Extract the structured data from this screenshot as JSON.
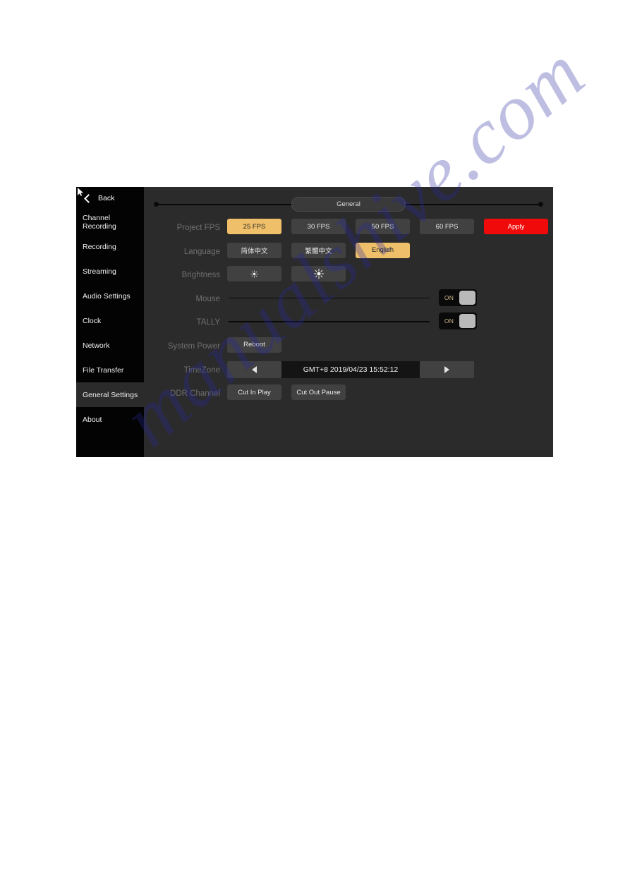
{
  "watermark": {
    "text": "manualshive.com"
  },
  "panel": {
    "topbar": {
      "section_label": "General"
    },
    "sidebar": {
      "back_label": "Back",
      "items": [
        {
          "label": "Channel Recording",
          "selected": false
        },
        {
          "label": "Recording",
          "selected": false
        },
        {
          "label": "Streaming",
          "selected": false
        },
        {
          "label": "Audio Settings",
          "selected": false
        },
        {
          "label": "Clock",
          "selected": false
        },
        {
          "label": "Network",
          "selected": false
        },
        {
          "label": "File Transfer",
          "selected": false
        },
        {
          "label": "General Settings",
          "selected": true
        },
        {
          "label": "About",
          "selected": false
        }
      ]
    },
    "rows": {
      "project_fps": {
        "label": "Project FPS",
        "options": [
          "25 FPS",
          "30 FPS",
          "50 FPS",
          "60 FPS"
        ],
        "selected": "25 FPS",
        "apply_label": "Apply"
      },
      "language": {
        "label": "Language",
        "options": [
          "简体中文",
          "繁體中文",
          "English"
        ],
        "selected": "English"
      },
      "brightness": {
        "label": "Brightness",
        "decrease_icon": "sun-small-icon",
        "increase_icon": "sun-large-icon"
      },
      "mouse": {
        "label": "Mouse",
        "toggle_state": "ON"
      },
      "tally": {
        "label": "TALLY",
        "toggle_state": "ON"
      },
      "system_power": {
        "label": "System Power",
        "reboot_label": "Reboot"
      },
      "timezone": {
        "label": "TimeZone",
        "prev_icon": "triangle-left-icon",
        "next_icon": "triangle-right-icon",
        "value": "GMT+8 2019/04/23 15:52:12"
      },
      "ddr_channel": {
        "label": "DDR Channel",
        "options": [
          "Cut In Play",
          "Cut Out Pause"
        ]
      }
    },
    "colors": {
      "accent_amber": "#efc069",
      "accent_red": "#f00a0a",
      "panel_bg": "#2b2b2b",
      "sidebar_bg": "#030303",
      "button_bg": "#414141"
    }
  }
}
